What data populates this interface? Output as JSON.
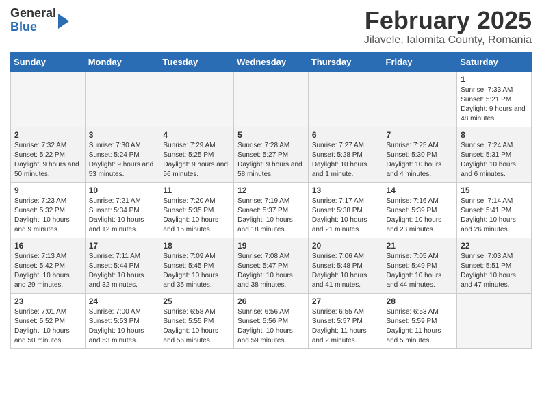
{
  "header": {
    "logo_line1": "General",
    "logo_line2": "Blue",
    "title": "February 2025",
    "subtitle": "Jilavele, Ialomita County, Romania"
  },
  "calendar": {
    "days_of_week": [
      "Sunday",
      "Monday",
      "Tuesday",
      "Wednesday",
      "Thursday",
      "Friday",
      "Saturday"
    ],
    "weeks": [
      [
        {
          "day": "",
          "info": ""
        },
        {
          "day": "",
          "info": ""
        },
        {
          "day": "",
          "info": ""
        },
        {
          "day": "",
          "info": ""
        },
        {
          "day": "",
          "info": ""
        },
        {
          "day": "",
          "info": ""
        },
        {
          "day": "1",
          "info": "Sunrise: 7:33 AM\nSunset: 5:21 PM\nDaylight: 9 hours and 48 minutes."
        }
      ],
      [
        {
          "day": "2",
          "info": "Sunrise: 7:32 AM\nSunset: 5:22 PM\nDaylight: 9 hours and 50 minutes."
        },
        {
          "day": "3",
          "info": "Sunrise: 7:30 AM\nSunset: 5:24 PM\nDaylight: 9 hours and 53 minutes."
        },
        {
          "day": "4",
          "info": "Sunrise: 7:29 AM\nSunset: 5:25 PM\nDaylight: 9 hours and 56 minutes."
        },
        {
          "day": "5",
          "info": "Sunrise: 7:28 AM\nSunset: 5:27 PM\nDaylight: 9 hours and 58 minutes."
        },
        {
          "day": "6",
          "info": "Sunrise: 7:27 AM\nSunset: 5:28 PM\nDaylight: 10 hours and 1 minute."
        },
        {
          "day": "7",
          "info": "Sunrise: 7:25 AM\nSunset: 5:30 PM\nDaylight: 10 hours and 4 minutes."
        },
        {
          "day": "8",
          "info": "Sunrise: 7:24 AM\nSunset: 5:31 PM\nDaylight: 10 hours and 6 minutes."
        }
      ],
      [
        {
          "day": "9",
          "info": "Sunrise: 7:23 AM\nSunset: 5:32 PM\nDaylight: 10 hours and 9 minutes."
        },
        {
          "day": "10",
          "info": "Sunrise: 7:21 AM\nSunset: 5:34 PM\nDaylight: 10 hours and 12 minutes."
        },
        {
          "day": "11",
          "info": "Sunrise: 7:20 AM\nSunset: 5:35 PM\nDaylight: 10 hours and 15 minutes."
        },
        {
          "day": "12",
          "info": "Sunrise: 7:19 AM\nSunset: 5:37 PM\nDaylight: 10 hours and 18 minutes."
        },
        {
          "day": "13",
          "info": "Sunrise: 7:17 AM\nSunset: 5:38 PM\nDaylight: 10 hours and 21 minutes."
        },
        {
          "day": "14",
          "info": "Sunrise: 7:16 AM\nSunset: 5:39 PM\nDaylight: 10 hours and 23 minutes."
        },
        {
          "day": "15",
          "info": "Sunrise: 7:14 AM\nSunset: 5:41 PM\nDaylight: 10 hours and 26 minutes."
        }
      ],
      [
        {
          "day": "16",
          "info": "Sunrise: 7:13 AM\nSunset: 5:42 PM\nDaylight: 10 hours and 29 minutes."
        },
        {
          "day": "17",
          "info": "Sunrise: 7:11 AM\nSunset: 5:44 PM\nDaylight: 10 hours and 32 minutes."
        },
        {
          "day": "18",
          "info": "Sunrise: 7:09 AM\nSunset: 5:45 PM\nDaylight: 10 hours and 35 minutes."
        },
        {
          "day": "19",
          "info": "Sunrise: 7:08 AM\nSunset: 5:47 PM\nDaylight: 10 hours and 38 minutes."
        },
        {
          "day": "20",
          "info": "Sunrise: 7:06 AM\nSunset: 5:48 PM\nDaylight: 10 hours and 41 minutes."
        },
        {
          "day": "21",
          "info": "Sunrise: 7:05 AM\nSunset: 5:49 PM\nDaylight: 10 hours and 44 minutes."
        },
        {
          "day": "22",
          "info": "Sunrise: 7:03 AM\nSunset: 5:51 PM\nDaylight: 10 hours and 47 minutes."
        }
      ],
      [
        {
          "day": "23",
          "info": "Sunrise: 7:01 AM\nSunset: 5:52 PM\nDaylight: 10 hours and 50 minutes."
        },
        {
          "day": "24",
          "info": "Sunrise: 7:00 AM\nSunset: 5:53 PM\nDaylight: 10 hours and 53 minutes."
        },
        {
          "day": "25",
          "info": "Sunrise: 6:58 AM\nSunset: 5:55 PM\nDaylight: 10 hours and 56 minutes."
        },
        {
          "day": "26",
          "info": "Sunrise: 6:56 AM\nSunset: 5:56 PM\nDaylight: 10 hours and 59 minutes."
        },
        {
          "day": "27",
          "info": "Sunrise: 6:55 AM\nSunset: 5:57 PM\nDaylight: 11 hours and 2 minutes."
        },
        {
          "day": "28",
          "info": "Sunrise: 6:53 AM\nSunset: 5:59 PM\nDaylight: 11 hours and 5 minutes."
        },
        {
          "day": "",
          "info": ""
        }
      ]
    ]
  }
}
